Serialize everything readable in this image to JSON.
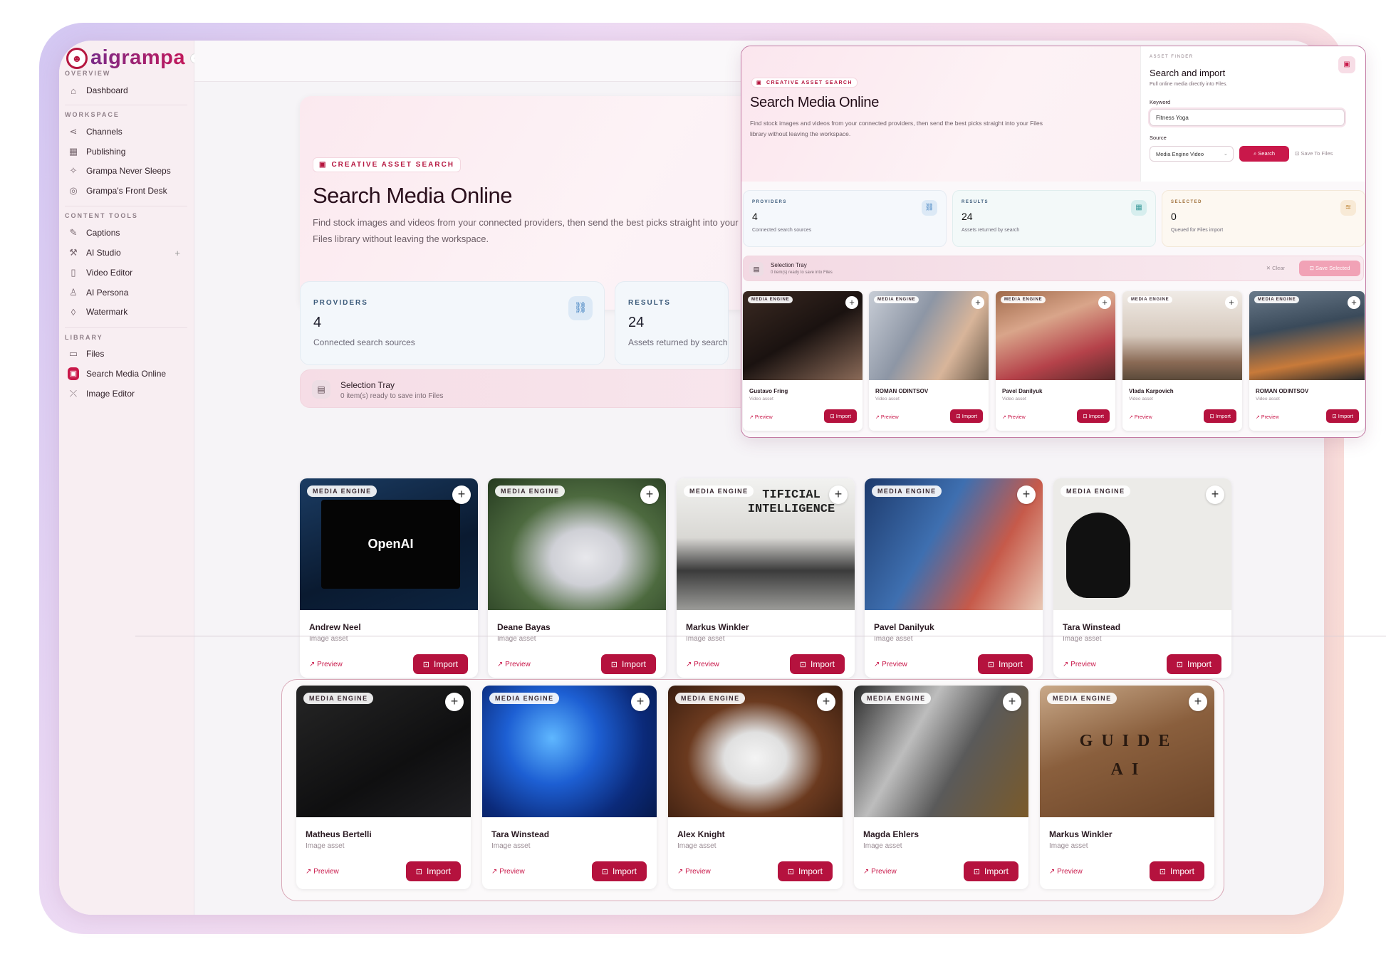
{
  "app": {
    "logo": "aigrampa",
    "brand_color": "#b5163f"
  },
  "sidebar": {
    "sections": [
      {
        "title": "OVERVIEW",
        "items": [
          {
            "label": "Dashboard",
            "icon": "home-icon"
          }
        ]
      },
      {
        "title": "WORKSPACE",
        "items": [
          {
            "label": "Channels",
            "icon": "share-icon"
          },
          {
            "label": "Publishing",
            "icon": "calendar-icon"
          },
          {
            "label": "Grampa Never Sleeps",
            "icon": "sparkle-icon"
          },
          {
            "label": "Grampa's Front Desk",
            "icon": "desk-icon"
          }
        ]
      },
      {
        "title": "CONTENT TOOLS",
        "items": [
          {
            "label": "Captions",
            "icon": "edit-icon"
          },
          {
            "label": "AI Studio",
            "icon": "wand-icon"
          },
          {
            "label": "Video Editor",
            "icon": "film-icon"
          },
          {
            "label": "AI Persona",
            "icon": "person-icon"
          },
          {
            "label": "Watermark",
            "icon": "drop-icon"
          }
        ]
      },
      {
        "title": "LIBRARY",
        "items": [
          {
            "label": "Files",
            "icon": "folder-icon"
          },
          {
            "label": "Search Media Online",
            "icon": "media-icon"
          },
          {
            "label": "Image Editor",
            "icon": "image-edit-icon"
          }
        ]
      }
    ],
    "ai_studio_plus": "+"
  },
  "hero": {
    "pill": "CREATIVE ASSET SEARCH",
    "title": "Search Media Online",
    "description": "Find stock images and videos from your connected providers, then send the best picks straight into your Files library without leaving the workspace."
  },
  "stats": [
    {
      "label": "PROVIDERS",
      "value": "4",
      "desc": "Connected search sources"
    },
    {
      "label": "RESULTS",
      "value": "24",
      "desc": "Assets returned by search"
    },
    {
      "label": "SELECTED",
      "value": "0",
      "desc": "Queued for Files import"
    }
  ],
  "tray": {
    "title": "Selection Tray",
    "subtitle": "0 item(s) ready to save into Files",
    "clear": "Clear",
    "save": "Save Selected"
  },
  "card_common": {
    "badge": "MEDIA ENGINE",
    "preview": "Preview",
    "import": "Import"
  },
  "image_cards_row1": [
    {
      "author": "Andrew Neel",
      "type": "Image asset",
      "overlay_text": "OpenAI"
    },
    {
      "author": "Deane Bayas",
      "type": "Image asset"
    },
    {
      "author": "Markus Winkler",
      "type": "Image asset",
      "overlay_text": "TIFICIAL INTELLIGENCE"
    },
    {
      "author": "Pavel Danilyuk",
      "type": "Image asset"
    },
    {
      "author": "Tara Winstead",
      "type": "Image asset"
    }
  ],
  "image_cards_row2": [
    {
      "author": "Matheus Bertelli",
      "type": "Image asset"
    },
    {
      "author": "Tara Winstead",
      "type": "Image asset"
    },
    {
      "author": "Alex Knight",
      "type": "Image asset"
    },
    {
      "author": "Magda Ehlers",
      "type": "Image asset"
    },
    {
      "author": "Markus Winkler",
      "type": "Image asset",
      "overlay_text": "GUIDE AI"
    }
  ],
  "finder": {
    "kicker": "ASSET FINDER",
    "title": "Search and import",
    "subtitle": "Pull online media directly into Files.",
    "keyword_label": "Keyword",
    "keyword_value": "Fitness Yoga",
    "source_label": "Source",
    "source_value": "Media Engine Video",
    "search_button": "Search",
    "save_button": "Save To Files"
  },
  "video_cards": [
    {
      "author": "Gustavo Fring",
      "type": "Video asset"
    },
    {
      "author": "ROMAN ODINTSOV",
      "type": "Video asset"
    },
    {
      "author": "Pavel Danilyuk",
      "type": "Video asset"
    },
    {
      "author": "Vlada Karpovich",
      "type": "Video asset"
    },
    {
      "author": "ROMAN ODINTSOV",
      "type": "Video asset"
    }
  ]
}
